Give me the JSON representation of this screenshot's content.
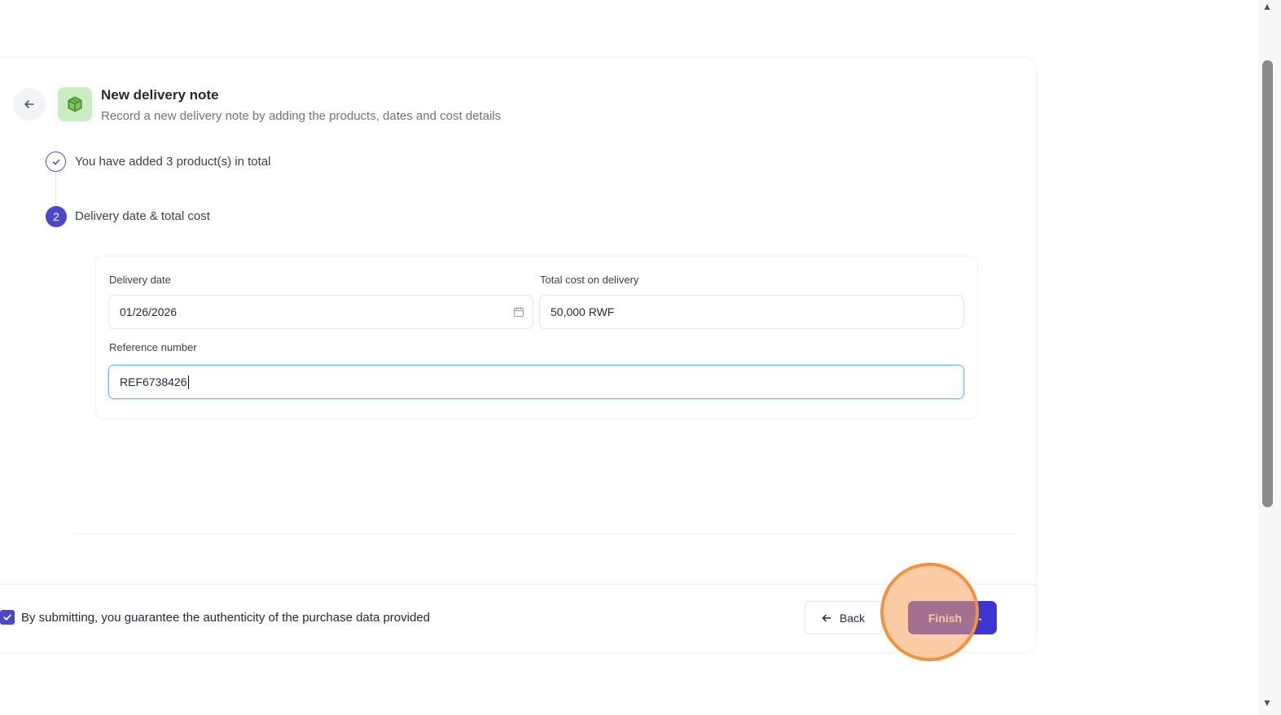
{
  "header": {
    "title": "New delivery note",
    "subtitle": "Record a new delivery note by adding the products, dates and cost details"
  },
  "steps": [
    {
      "number": "",
      "label": "You have added 3 product(s) in total",
      "status": "completed"
    },
    {
      "number": "2",
      "label": "Delivery date & total cost",
      "status": "active"
    }
  ],
  "form": {
    "delivery_date_label": "Delivery date",
    "delivery_date_value": "01/26/2026",
    "total_cost_label": "Total cost on delivery",
    "total_cost_value": "50,000 RWF",
    "reference_label": "Reference number",
    "reference_value": "REF6738426"
  },
  "footer": {
    "consent_text": "By submitting, you guarantee the authenticity of the purchase data provided",
    "consent_checked": true,
    "back_label": "Back",
    "finish_label": "Finish"
  },
  "colors": {
    "primary": "#4a47c9",
    "icon_bg": "#c9ecc0",
    "click_indicator": "#f2923c"
  },
  "icons": {
    "header_back": "arrow-left-icon",
    "package": "package-icon",
    "step_done": "check-icon",
    "calendar": "calendar-icon",
    "back_button": "arrow-left-icon",
    "finish_button": "arrow-right-icon"
  }
}
